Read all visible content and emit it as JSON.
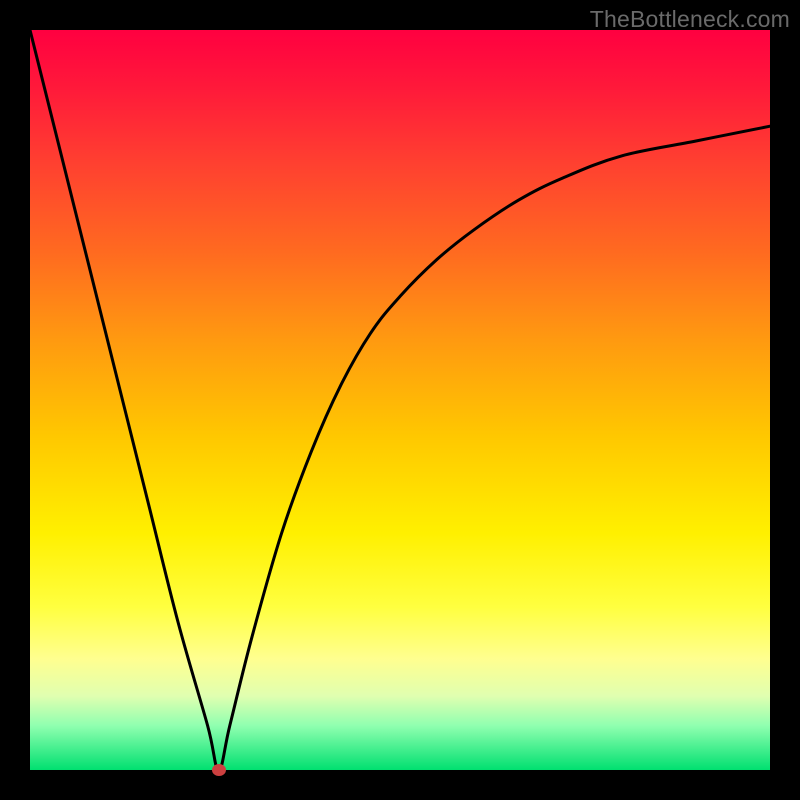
{
  "watermark": "TheBottleneck.com",
  "chart_data": {
    "type": "line",
    "title": "",
    "xlabel": "",
    "ylabel": "",
    "xlim": [
      0,
      100
    ],
    "ylim": [
      0,
      100
    ],
    "grid": false,
    "legend": false,
    "background_gradient": {
      "top_color": "#ff0040",
      "mid_color": "#ffe000",
      "bottom_color": "#00e070",
      "note": "vertical gradient from red (top, bad) through orange/yellow to green (bottom, good)"
    },
    "series": [
      {
        "name": "bottleneck-curve",
        "x": [
          0,
          4,
          8,
          12,
          16,
          20,
          24,
          25.5,
          27,
          30,
          34,
          38,
          42,
          46,
          50,
          55,
          60,
          66,
          72,
          80,
          90,
          100
        ],
        "y": [
          100,
          84,
          68,
          52,
          36,
          20,
          6,
          0,
          6,
          18,
          32,
          43,
          52,
          59,
          64,
          69,
          73,
          77,
          80,
          83,
          85,
          87
        ],
        "color": "#000000",
        "width": 3
      }
    ],
    "annotations": [
      {
        "name": "minimum-marker",
        "type": "point",
        "x": 25.5,
        "y": 0,
        "color": "#cc4040"
      }
    ]
  }
}
